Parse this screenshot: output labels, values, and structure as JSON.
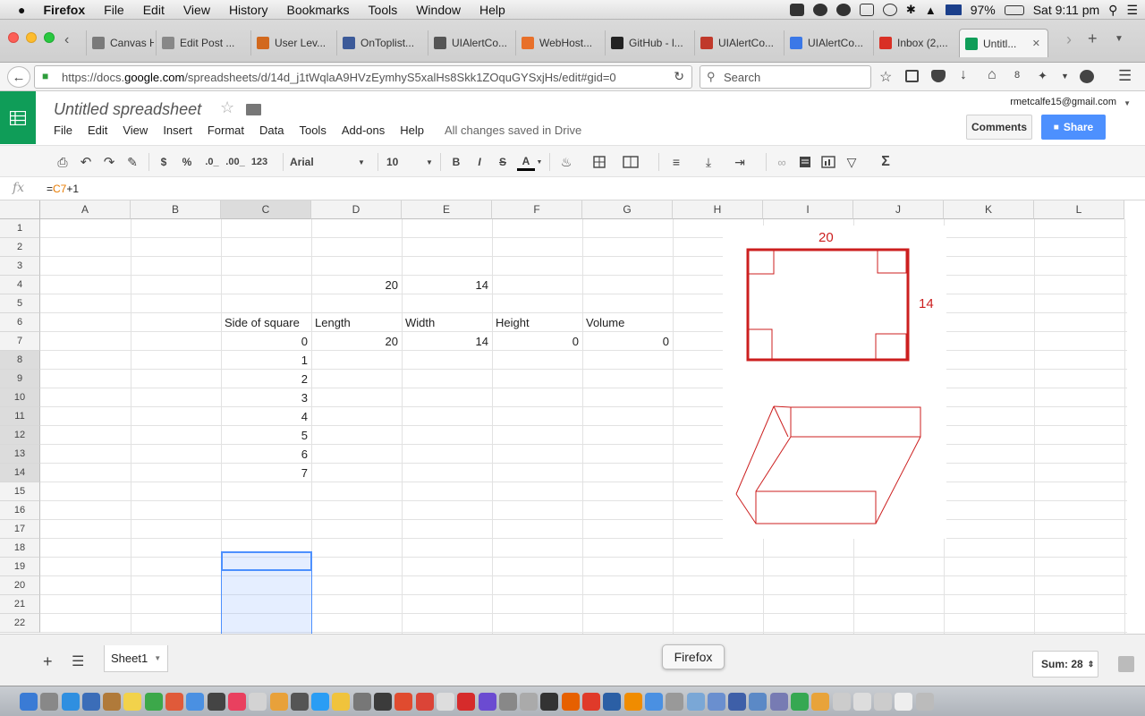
{
  "mac_menu": {
    "apple": "",
    "app": "Firefox",
    "items": [
      "File",
      "Edit",
      "View",
      "History",
      "Bookmarks",
      "Tools",
      "Window",
      "Help"
    ],
    "battery": "97%",
    "clock": "Sat 9:11 pm"
  },
  "tabs": [
    {
      "label": "Canvas H...",
      "color": "#7a7a7a"
    },
    {
      "label": "Edit Post ...",
      "color": "#888888"
    },
    {
      "label": "User Lev...",
      "color": "#d2691e"
    },
    {
      "label": "OnToplist...",
      "color": "#3c5a99"
    },
    {
      "label": "UIAlertCo...",
      "color": "#555555"
    },
    {
      "label": "WebHost...",
      "color": "#e8702a"
    },
    {
      "label": "GitHub - l...",
      "color": "#222222"
    },
    {
      "label": "UIAlertCo...",
      "color": "#c0392b"
    },
    {
      "label": "UIAlertCo...",
      "color": "#3b78e7"
    },
    {
      "label": "Inbox (2,...",
      "color": "#d93025"
    },
    {
      "label": "Untitl...",
      "color": "#0f9d58",
      "active": true
    }
  ],
  "nav": {
    "url_prefix": "https://docs.",
    "url_domain": "google.com",
    "url_rest": "/spreadsheets/d/14d_j1tWqlaA9HVzEymhyS5xalHs8Skk1ZOquGYSxjHs/edit#gid=0",
    "search_placeholder": "Search",
    "badge": "8"
  },
  "doc": {
    "title": "Untitled spreadsheet",
    "menu": [
      "File",
      "Edit",
      "View",
      "Insert",
      "Format",
      "Data",
      "Tools",
      "Add-ons",
      "Help"
    ],
    "saved_status": "All changes saved in Drive",
    "user_email": "rmetcalfe15@gmail.com",
    "comments_label": "Comments",
    "share_label": "Share"
  },
  "toolbar": {
    "dollar": "$",
    "percent": "%",
    "dec_decrease": ".0_",
    "dec_increase": ".00_",
    "number_format": "123",
    "font": "Arial",
    "font_size": "10",
    "bold": "B",
    "italic": "I",
    "strike": "S",
    "text_color": "A",
    "sigma": "Σ"
  },
  "formula_bar": {
    "fx": "fx",
    "prefix": "=",
    "ref": "C7",
    "suffix": "+1"
  },
  "grid": {
    "columns": [
      "A",
      "B",
      "C",
      "D",
      "E",
      "F",
      "G",
      "H",
      "I",
      "J",
      "K",
      "L"
    ],
    "selected_column": "C",
    "rows": [
      "1",
      "2",
      "3",
      "4",
      "5",
      "6",
      "7",
      "8",
      "9",
      "10",
      "11",
      "12",
      "13",
      "14",
      "15",
      "16",
      "17",
      "18",
      "19",
      "20",
      "21",
      "22"
    ],
    "selected_rows": [
      "8",
      "9",
      "10",
      "11",
      "12",
      "13",
      "14"
    ],
    "cells": {
      "D4": "20",
      "E4": "14",
      "C6": "Side of square",
      "D6": "Length",
      "E6": "Width",
      "F6": "Height",
      "G6": "Volume",
      "C7": "0",
      "D7": "20",
      "E7": "14",
      "F7": "0",
      "G7": "0",
      "C8": "1",
      "C9": "2",
      "C10": "3",
      "C11": "4",
      "C12": "5",
      "C13": "6",
      "C14": "7"
    }
  },
  "drawing": {
    "top_label": "20",
    "side_label": "14",
    "stroke_color": "#cc1f1f"
  },
  "bottom": {
    "sheet_tab": "Sheet1",
    "sum": "Sum: 28",
    "tooltip": "Firefox"
  }
}
